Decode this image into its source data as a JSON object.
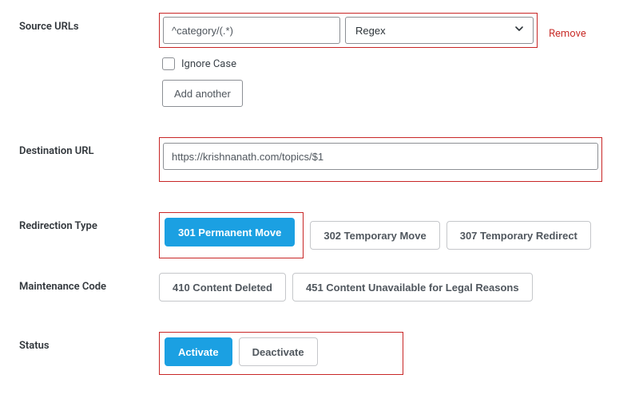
{
  "sourceUrls": {
    "label": "Source URLs",
    "pattern": "^category/(.*)",
    "matchType": "Regex",
    "removeLabel": "Remove",
    "ignoreCaseLabel": "Ignore Case",
    "addAnotherLabel": "Add another"
  },
  "destination": {
    "label": "Destination URL",
    "value": "https://krishnanath.com/topics/$1"
  },
  "redirectionType": {
    "label": "Redirection Type",
    "options": [
      {
        "label": "301 Permanent Move",
        "active": true
      },
      {
        "label": "302 Temporary Move",
        "active": false
      },
      {
        "label": "307 Temporary Redirect",
        "active": false
      }
    ]
  },
  "maintenanceCode": {
    "label": "Maintenance Code",
    "options": [
      {
        "label": "410 Content Deleted"
      },
      {
        "label": "451 Content Unavailable for Legal Reasons"
      }
    ]
  },
  "status": {
    "label": "Status",
    "options": [
      {
        "label": "Activate",
        "active": true
      },
      {
        "label": "Deactivate",
        "active": false
      }
    ]
  }
}
